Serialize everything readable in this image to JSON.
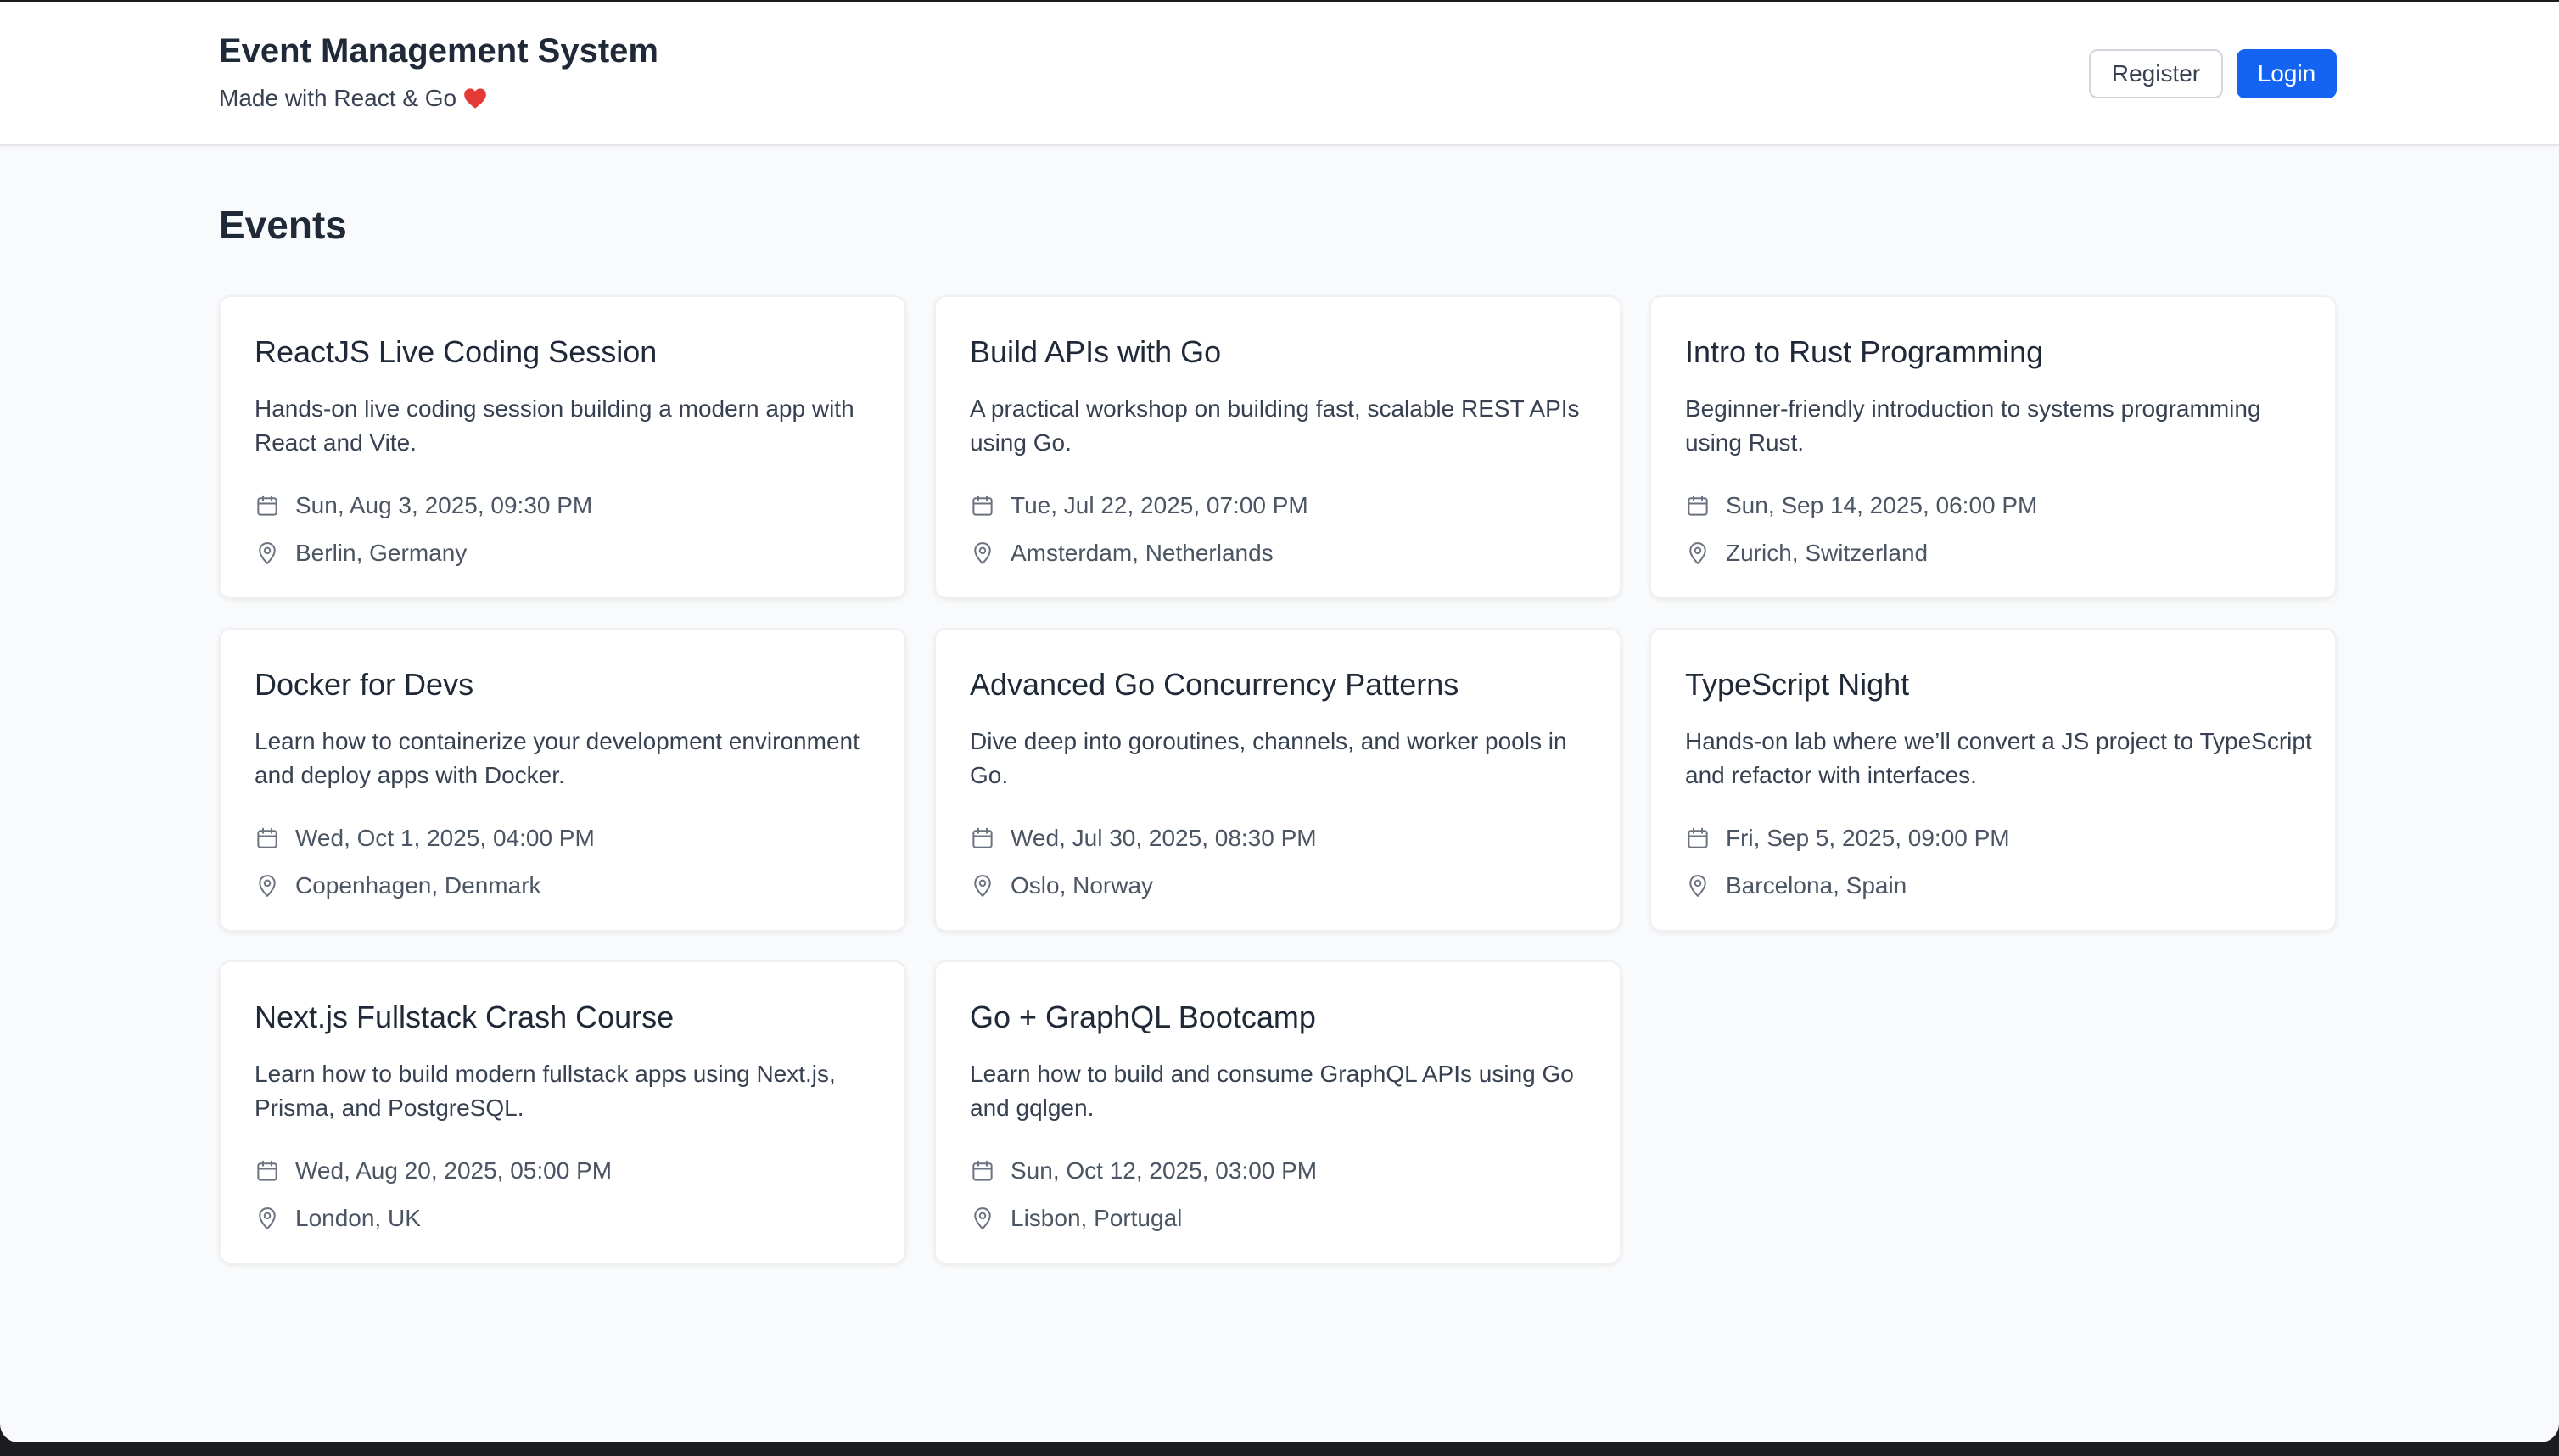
{
  "header": {
    "title": "Event Management System",
    "subtitle": "Made with React & Go",
    "subtitle_icon": "heart-icon",
    "register_label": "Register",
    "login_label": "Login",
    "accent_color": "#1463f3"
  },
  "main": {
    "heading": "Events",
    "events": [
      {
        "title": "ReactJS Live Coding Session",
        "description": "Hands-on live coding session building a modern app with React and Vite.",
        "date": "Sun, Aug 3, 2025, 09:30 PM",
        "location": "Berlin, Germany"
      },
      {
        "title": "Build APIs with Go",
        "description": "A practical workshop on building fast, scalable REST APIs using Go.",
        "date": "Tue, Jul 22, 2025, 07:00 PM",
        "location": "Amsterdam, Netherlands"
      },
      {
        "title": "Intro to Rust Programming",
        "description": "Beginner-friendly introduction to systems programming using Rust.",
        "date": "Sun, Sep 14, 2025, 06:00 PM",
        "location": "Zurich, Switzerland"
      },
      {
        "title": "Docker for Devs",
        "description": "Learn how to containerize your development environment and deploy apps with Docker.",
        "date": "Wed, Oct 1, 2025, 04:00 PM",
        "location": "Copenhagen, Denmark"
      },
      {
        "title": "Advanced Go Concurrency Patterns",
        "description": "Dive deep into goroutines, channels, and worker pools in Go.",
        "date": "Wed, Jul 30, 2025, 08:30 PM",
        "location": "Oslo, Norway"
      },
      {
        "title": "TypeScript Night",
        "description": "Hands-on lab where we’ll convert a JS project to TypeScript and refactor with interfaces.",
        "date": "Fri, Sep 5, 2025, 09:00 PM",
        "location": "Barcelona, Spain"
      },
      {
        "title": "Next.js Fullstack Crash Course",
        "description": "Learn how to build modern fullstack apps using Next.js, Prisma, and PostgreSQL.",
        "date": "Wed, Aug 20, 2025, 05:00 PM",
        "location": "London, UK"
      },
      {
        "title": "Go + GraphQL Bootcamp",
        "description": "Learn how to build and consume GraphQL APIs using Go and gqlgen.",
        "date": "Sun, Oct 12, 2025, 03:00 PM",
        "location": "Lisbon, Portugal"
      }
    ]
  }
}
